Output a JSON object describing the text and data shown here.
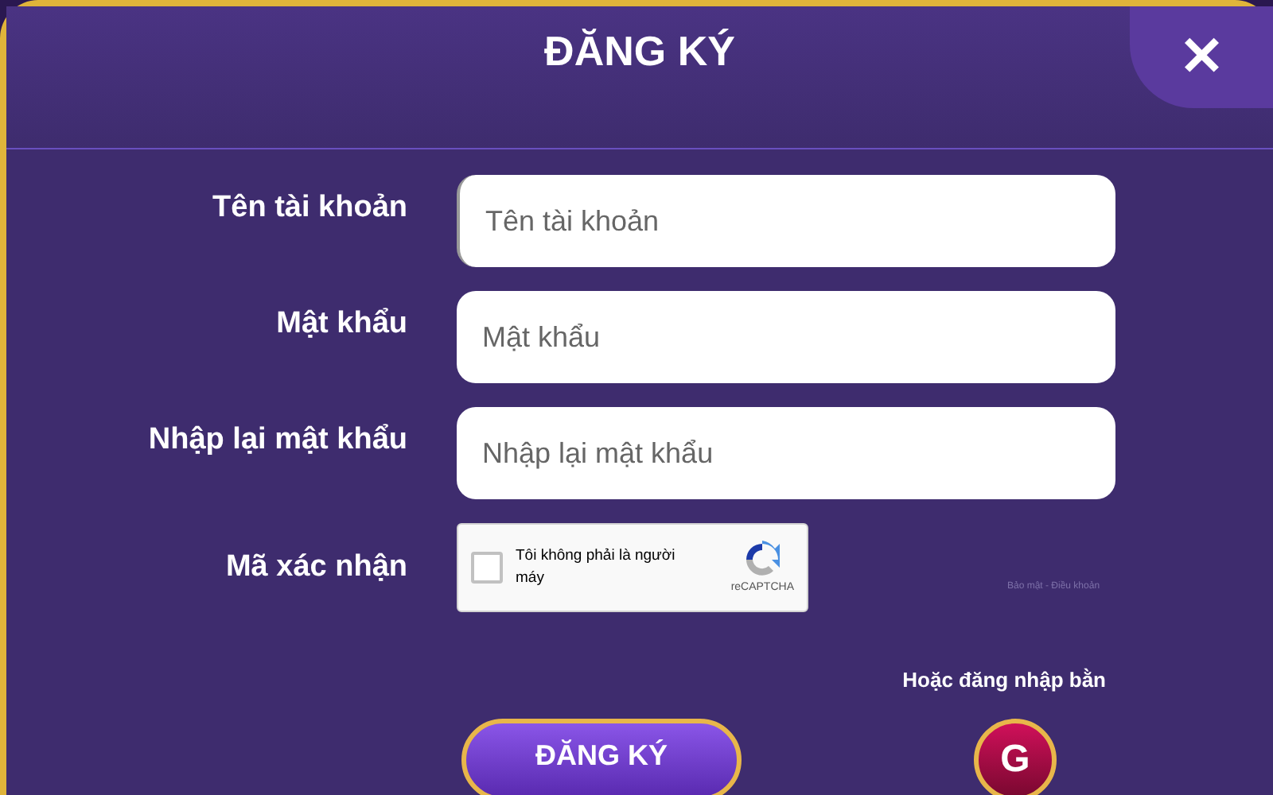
{
  "dialog": {
    "title": "ĐĂNG KÝ",
    "close": "✕"
  },
  "fields": [
    {
      "label": "Tên tài khoản",
      "placeholder": "Tên tài khoản",
      "focused": true
    },
    {
      "label": "Mật khẩu",
      "placeholder": "Mật khẩu",
      "focused": false
    },
    {
      "label": "Nhập lại mật khẩu",
      "placeholder": "Nhập lại mật khẩu",
      "focused": false
    }
  ],
  "captcha": {
    "label": "Mã xác nhận",
    "text": "Tôi không phải là người máy",
    "checked": false,
    "brand": "reCAPTCHA",
    "terms": "Bảo mật - Điều khoản"
  },
  "alt_login": {
    "text": "Hoặc đăng nhập bằn",
    "google": "G"
  },
  "submit": "ĐĂNG KÝ"
}
